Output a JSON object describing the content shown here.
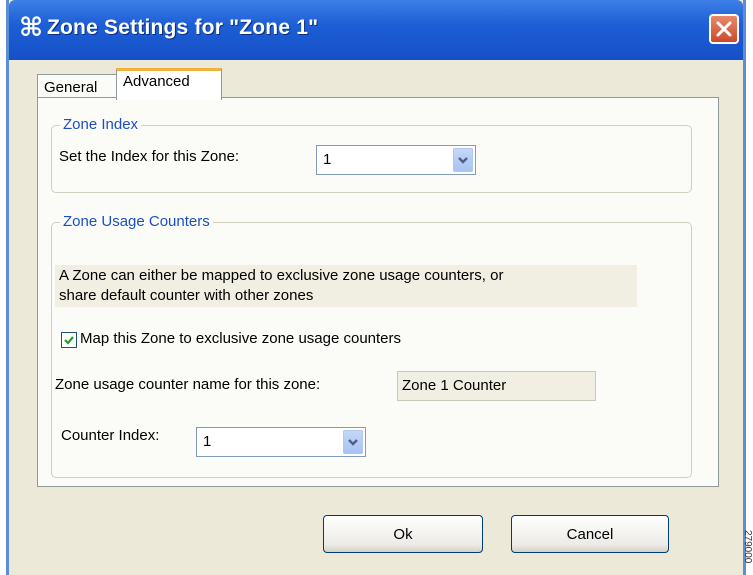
{
  "window": {
    "title": "Zone Settings for \"Zone 1\"",
    "icon": "zone-settings-icon",
    "close_icon": "close-icon"
  },
  "tabs": [
    {
      "label": "General",
      "selected": false
    },
    {
      "label": "Advanced",
      "selected": true
    }
  ],
  "zone_index": {
    "legend": "Zone Index",
    "label": "Set the Index for this Zone:",
    "value": "1"
  },
  "usage_counters": {
    "legend": "Zone Usage Counters",
    "description_line1": "A Zone can either be mapped to exclusive zone usage counters, or",
    "description_line2": "share default counter with other zones",
    "checkbox_label": "Map this Zone to exclusive zone usage counters",
    "checkbox_checked": true,
    "counter_name_label": "Zone usage counter name for this zone:",
    "counter_name_value": "Zone 1 Counter",
    "counter_index_label": "Counter Index:",
    "counter_index_value": "1"
  },
  "buttons": {
    "ok": "Ok",
    "cancel": "Cancel"
  },
  "side_text": "279000",
  "colors": {
    "titlebar": "#1d5fd6",
    "legend_text": "#1c4fc4",
    "dialog_bg": "#ece9d8",
    "tab_highlight": "#f2b33d",
    "close_button": "#cc4a2a"
  }
}
